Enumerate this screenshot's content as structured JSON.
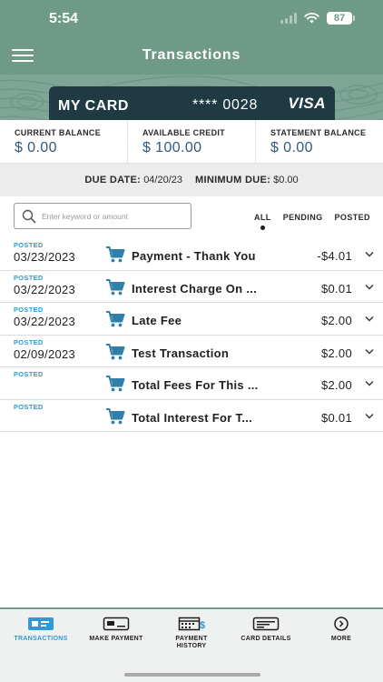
{
  "status_bar": {
    "time": "5:54",
    "battery": "87"
  },
  "header": {
    "title": "Transactions",
    "menu_icon": "hamburger-menu-icon"
  },
  "card": {
    "name": "MY CARD",
    "number": "**** 0028",
    "brand": "VISA"
  },
  "balances": [
    {
      "label": "CURRENT BALANCE",
      "value": "$ 0.00"
    },
    {
      "label": "AVAILABLE CREDIT",
      "value": "$ 100.00"
    },
    {
      "label": "STATEMENT BALANCE",
      "value": "$ 0.00"
    }
  ],
  "due": {
    "date_label": "DUE DATE:",
    "date_value": "04/20/23",
    "min_label": "MINIMUM DUE:",
    "min_value": "$0.00"
  },
  "search": {
    "placeholder": "Enter keyword or amount"
  },
  "filters": {
    "all": "ALL",
    "pending": "PENDING",
    "posted": "POSTED",
    "active": "all"
  },
  "transactions": [
    {
      "status": "POSTED",
      "date": "03/23/2023",
      "description": "Payment - Thank You",
      "amount": "-$4.01"
    },
    {
      "status": "POSTED",
      "date": "03/22/2023",
      "description": "Interest Charge On ...",
      "amount": "$0.01"
    },
    {
      "status": "POSTED",
      "date": "03/22/2023",
      "description": "Late Fee",
      "amount": "$2.00"
    },
    {
      "status": "POSTED",
      "date": "02/09/2023",
      "description": "Test Transaction",
      "amount": "$2.00"
    },
    {
      "status": "POSTED",
      "date": "",
      "description": "Total Fees For This ...",
      "amount": "$2.00"
    },
    {
      "status": "POSTED",
      "date": "",
      "description": "Total Interest For T...",
      "amount": "$0.01"
    }
  ],
  "tabs": {
    "transactions": "TRANSACTIONS",
    "make_payment": "MAKE PAYMENT",
    "payment_history_1": "PAYMENT",
    "payment_history_2": "HISTORY",
    "card_details": "CARD DETAILS",
    "more": "MORE"
  },
  "colors": {
    "header": "#6f9a88",
    "card": "#1f3a43",
    "balance_text": "#2f5a80",
    "accent": "#2e9bd6",
    "icon": "#2f7fa8"
  }
}
